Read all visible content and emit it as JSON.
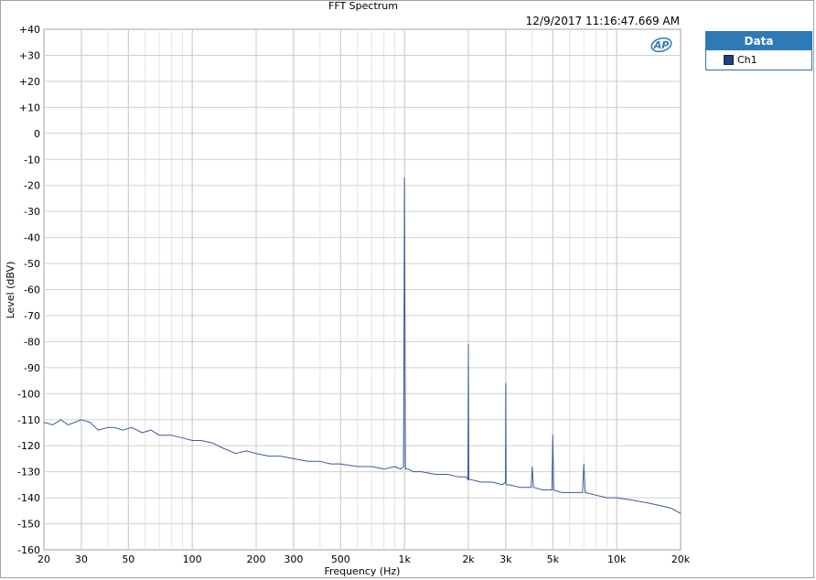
{
  "window": {
    "title": "FFT Spectrum",
    "timestamp": "12/9/2017 11:16:47.669 AM"
  },
  "logo": {
    "text": "AP"
  },
  "legend": {
    "header": "Data",
    "items": [
      {
        "label": "Ch1",
        "color": "#1f3f80"
      }
    ]
  },
  "chart_data": {
    "type": "line",
    "title": "FFT Spectrum",
    "xlabel": "Frequency (Hz)",
    "ylabel": "Level (dBV)",
    "xscale": "log",
    "xlim": [
      20,
      20000
    ],
    "ylim": [
      -160,
      40
    ],
    "x_ticks": [
      {
        "v": 20,
        "label": "20"
      },
      {
        "v": 30,
        "label": "30"
      },
      {
        "v": 50,
        "label": "50"
      },
      {
        "v": 100,
        "label": "100"
      },
      {
        "v": 200,
        "label": "200"
      },
      {
        "v": 300,
        "label": "300"
      },
      {
        "v": 500,
        "label": "500"
      },
      {
        "v": 1000,
        "label": "1k"
      },
      {
        "v": 2000,
        "label": "2k"
      },
      {
        "v": 3000,
        "label": "3k"
      },
      {
        "v": 5000,
        "label": "5k"
      },
      {
        "v": 10000,
        "label": "10k"
      },
      {
        "v": 20000,
        "label": "20k"
      }
    ],
    "y_ticks": [
      {
        "v": 40,
        "label": "+40"
      },
      {
        "v": 30,
        "label": "+30"
      },
      {
        "v": 20,
        "label": "+20"
      },
      {
        "v": 10,
        "label": "+10"
      },
      {
        "v": 0,
        "label": "0"
      },
      {
        "v": -10,
        "label": "-10"
      },
      {
        "v": -20,
        "label": "-20"
      },
      {
        "v": -30,
        "label": "-30"
      },
      {
        "v": -40,
        "label": "-40"
      },
      {
        "v": -50,
        "label": "-50"
      },
      {
        "v": -60,
        "label": "-60"
      },
      {
        "v": -70,
        "label": "-70"
      },
      {
        "v": -80,
        "label": "-80"
      },
      {
        "v": -90,
        "label": "-90"
      },
      {
        "v": -100,
        "label": "-100"
      },
      {
        "v": -110,
        "label": "-110"
      },
      {
        "v": -120,
        "label": "-120"
      },
      {
        "v": -130,
        "label": "-130"
      },
      {
        "v": -140,
        "label": "-140"
      },
      {
        "v": -150,
        "label": "-150"
      },
      {
        "v": -160,
        "label": "-160"
      }
    ],
    "grid": true,
    "legend_position": "outside-right-top",
    "series": [
      {
        "name": "Ch1",
        "color": "#3b5b9a",
        "x": [
          20,
          22,
          24,
          26,
          28,
          30,
          33,
          36,
          40,
          43,
          47,
          52,
          58,
          64,
          70,
          80,
          90,
          100,
          110,
          125,
          140,
          160,
          180,
          200,
          230,
          260,
          300,
          350,
          400,
          450,
          500,
          600,
          700,
          800,
          900,
          960,
          990,
          1000,
          1010,
          1040,
          1100,
          1200,
          1400,
          1600,
          1800,
          1950,
          1990,
          2000,
          2010,
          2050,
          2300,
          2600,
          2900,
          2990,
          3000,
          3010,
          3100,
          3500,
          3950,
          4000,
          4050,
          4500,
          4950,
          5000,
          5050,
          5500,
          6000,
          6900,
          7000,
          7100,
          8000,
          9000,
          10000,
          12000,
          14000,
          16000,
          18000,
          20000
        ],
        "y": [
          -111,
          -112,
          -110,
          -112,
          -111,
          -110,
          -111,
          -114,
          -113,
          -113,
          -114,
          -113,
          -115,
          -114,
          -116,
          -116,
          -117,
          -118,
          -118,
          -119,
          -121,
          -123,
          -122,
          -123,
          -124,
          -124,
          -125,
          -126,
          -126,
          -127,
          -127,
          -128,
          -128,
          -129,
          -128,
          -129,
          -128,
          -17,
          -129,
          -129,
          -130,
          -130,
          -131,
          -131,
          -132,
          -132,
          -133,
          -81,
          -133,
          -133,
          -134,
          -134,
          -135,
          -134,
          -96,
          -135,
          -135,
          -136,
          -136,
          -128,
          -136,
          -137,
          -137,
          -116,
          -137,
          -138,
          -138,
          -138,
          -127,
          -138,
          -139,
          -140,
          -140,
          -141,
          -142,
          -143,
          -144,
          -146
        ]
      }
    ]
  }
}
